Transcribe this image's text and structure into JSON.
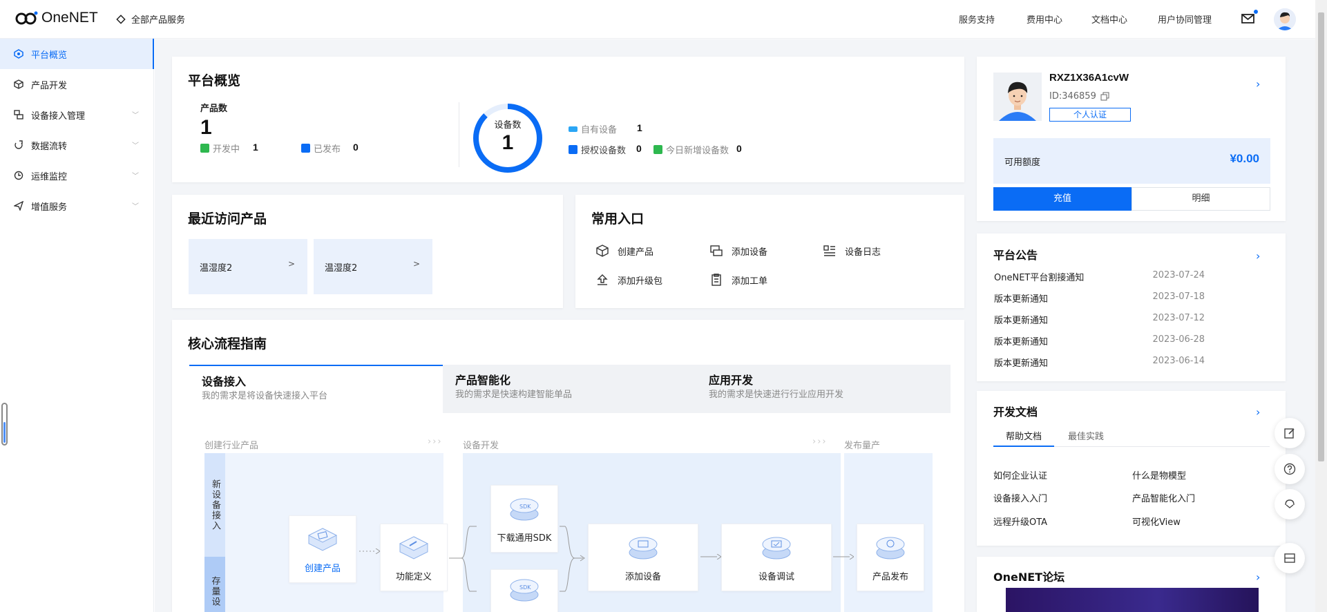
{
  "header": {
    "brand": "OneNET",
    "all_products": "全部产品服务",
    "nav": [
      "服务支持",
      "费用中心",
      "文档中心",
      "用户协同管理"
    ]
  },
  "sidebar": {
    "items": [
      {
        "label": "平台概览",
        "icon": "platform-icon",
        "active": true
      },
      {
        "label": "产品开发",
        "icon": "cube-icon"
      },
      {
        "label": "设备接入管理",
        "icon": "device-icon"
      },
      {
        "label": "数据流转",
        "icon": "dataflow-icon"
      },
      {
        "label": "运维监控",
        "icon": "monitor-icon"
      },
      {
        "label": "增值服务",
        "icon": "send-icon"
      }
    ]
  },
  "overview": {
    "title": "平台概览",
    "product_count_label": "产品数",
    "product_count": "1",
    "developing_label": "开发中",
    "developing": "1",
    "published_label": "已发布",
    "published": "0",
    "device_count_label": "设备数",
    "device_count": "1",
    "own_devices_label": "自有设备",
    "own_devices": "1",
    "auth_devices_label": "授权设备数",
    "auth_devices": "0",
    "today_new_label": "今日新增设备数",
    "today_new": "0",
    "colors": {
      "accent": "#0a6cf5",
      "green": "#2eb84f"
    }
  },
  "recent": {
    "title": "最近访问产品",
    "items": [
      "温湿度2",
      "温湿度2"
    ]
  },
  "quick": {
    "title": "常用入口",
    "items": [
      "创建产品",
      "添加设备",
      "设备日志",
      "添加升级包",
      "添加工单"
    ]
  },
  "guide": {
    "title": "核心流程指南",
    "tabs": [
      {
        "title": "设备接入",
        "sub": "我的需求是将设备快速接入平台"
      },
      {
        "title": "产品智能化",
        "sub": "我的需求是快速构建智能单品"
      },
      {
        "title": "应用开发",
        "sub": "我的需求是快速进行行业应用开发"
      }
    ],
    "phases": [
      "创建行业产品",
      "设备开发",
      "发布量产"
    ],
    "lanes": [
      "新设备接入",
      "存量设"
    ],
    "nodes": [
      "创建产品",
      "功能定义",
      "下载通用SDK",
      "添加设备",
      "设备调试",
      "产品发布"
    ]
  },
  "account": {
    "name": "RXZ1X36A1cvW",
    "id": "ID:346859",
    "verify": "个人认证",
    "balance_label": "可用额度",
    "balance": "¥0.00",
    "recharge": "充值",
    "detail": "明细"
  },
  "announcements": {
    "title": "平台公告",
    "items": [
      {
        "text": "OneNET平台割接通知",
        "date": "2023-07-24"
      },
      {
        "text": "版本更新通知",
        "date": "2023-07-18"
      },
      {
        "text": "版本更新通知",
        "date": "2023-07-12"
      },
      {
        "text": "版本更新通知",
        "date": "2023-06-28"
      },
      {
        "text": "版本更新通知",
        "date": "2023-06-14"
      }
    ]
  },
  "docs": {
    "title": "开发文档",
    "tabs": [
      "帮助文档",
      "最佳实践"
    ],
    "links": [
      "如何企业认证",
      "什么是物模型",
      "设备接入入门",
      "产品智能化入门",
      "远程升级OTA",
      "可视化View"
    ]
  },
  "forum": {
    "title": "OneNET论坛"
  }
}
